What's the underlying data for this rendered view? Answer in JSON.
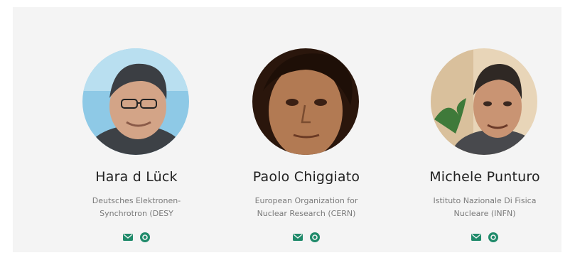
{
  "people": [
    {
      "name": "Hara d Lück",
      "org_line1": "Deutsches Elektronen-",
      "org_line2": "Synchrotron (DESY",
      "icons": [
        "email-icon",
        "orcid-icon"
      ]
    },
    {
      "name": "Paolo Chiggiato",
      "org_line1": "European Organization for",
      "org_line2": "Nuclear Research (CERN)",
      "icons": [
        "email-icon",
        "orcid-icon"
      ]
    },
    {
      "name": "Michele Punturo",
      "org_line1": "Istituto Nazionale Di Fisica",
      "org_line2": "Nucleare (INFN)",
      "icons": [
        "email-icon",
        "orcid-icon"
      ]
    }
  ],
  "colors": {
    "accent": "#1f8a6a",
    "panel": "#f4f4f4",
    "name": "#222222",
    "org": "#7a7a7a"
  }
}
